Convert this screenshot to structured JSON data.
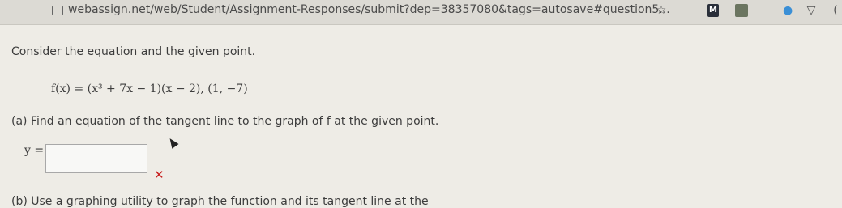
{
  "browser": {
    "url": "webassign.net/web/Student/Assignment-Responses/submit?dep=38357080&tags=autosave#question5..."
  },
  "toolbar_icons": [
    "star-icon",
    "extension-icon",
    "extension-icon",
    "extension-icon",
    "extension-icon",
    "extension-icon"
  ],
  "question": {
    "intro": "Consider the equation and the given point.",
    "equation": "f(x) = (x³ + 7x − 1)(x − 2),   (1, −7)",
    "part_a": "(a)  Find an equation of the tangent line to the graph of f at the given point.",
    "answer_label": "y =",
    "answer_value": "",
    "result_icon": "incorrect-icon",
    "part_b": "(b)  Use a graphing utility to graph the function and its tangent line at the"
  },
  "colors": {
    "incorrect": "#c81f1f"
  }
}
